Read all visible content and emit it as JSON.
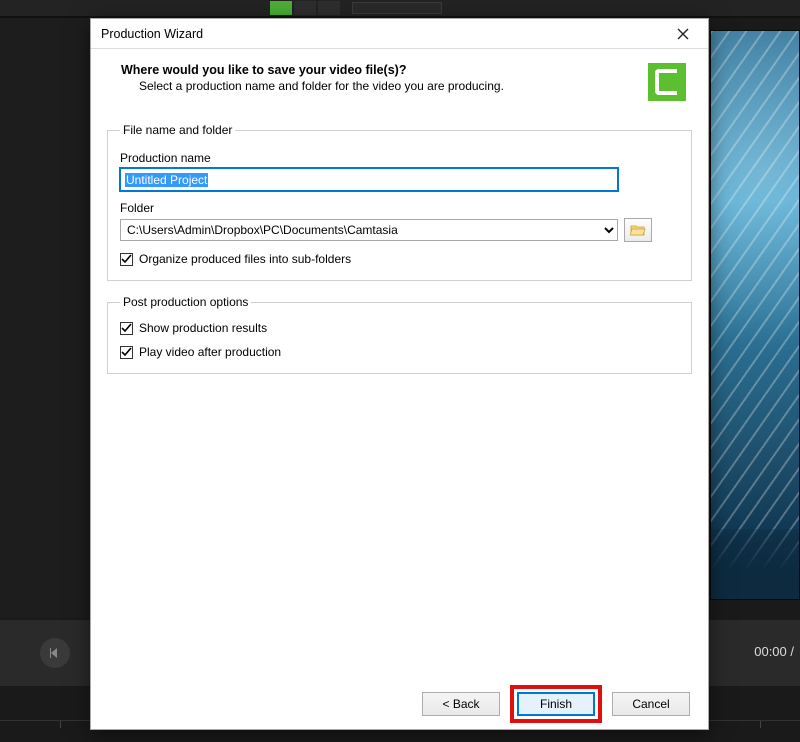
{
  "dialog": {
    "title": "Production Wizard",
    "question": "Where would you like to save your video file(s)?",
    "subtitle": "Select a production name and folder for the video you are producing."
  },
  "group_file": {
    "legend": "File name and folder",
    "name_label": "Production name",
    "name_value": "Untitled Project",
    "folder_label": "Folder",
    "folder_value": "C:\\Users\\Admin\\Dropbox\\PC\\Documents\\Camtasia",
    "organize_label": "Organize produced files into sub-folders"
  },
  "group_post": {
    "legend": "Post production options",
    "show_results_label": "Show production results",
    "play_label": "Play video after production"
  },
  "buttons": {
    "back": "< Back",
    "finish": "Finish",
    "cancel": "Cancel"
  },
  "player": {
    "time": "00:00 /"
  }
}
